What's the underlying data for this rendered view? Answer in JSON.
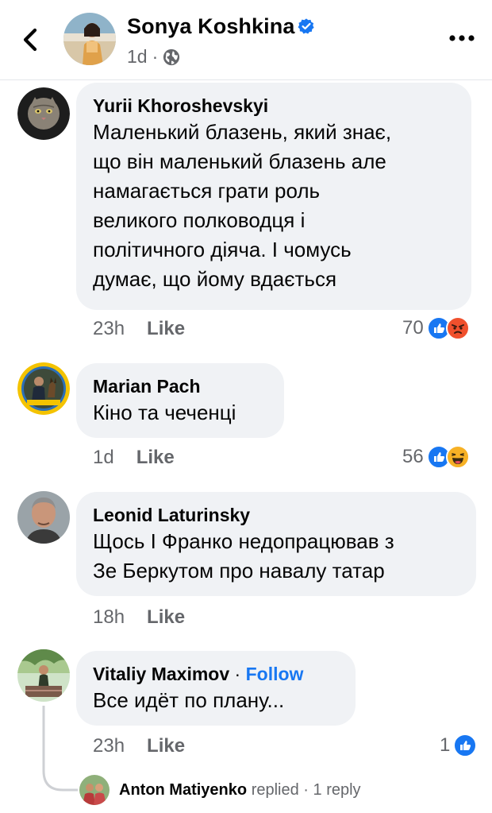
{
  "header": {
    "back_label": "Back",
    "author": "Sonya Koshkina",
    "time": "1d",
    "separator": "·",
    "verified_icon": "verified-badge-icon",
    "privacy_icon": "globe-icon",
    "more_icon": "more-horizontal-icon"
  },
  "colors": {
    "accent": "#1877f2",
    "bubble": "#f0f2f5",
    "secondary_text": "#65676b",
    "angry": "#f0502d",
    "haha": "#f7b125"
  },
  "comments": [
    {
      "author": "Yurii Khoroshevskyi",
      "avatar_icon": "cat-badge-avatar",
      "avatar_badge_text": "YOU DON'T SCARE ME · I HAVE A CAT",
      "text": "Маленький блазень, який знає,\nщо він маленький блазень але\nнамагається грати роль\nвеликого полководця і\nполітичного діяча. І чомусь\nдумає, що йому вдається",
      "time": "23h",
      "like": "Like",
      "reaction_count": "70",
      "reactions": [
        "like",
        "angry"
      ]
    },
    {
      "author": "Marian Pach",
      "avatar_icon": "soldier-with-dog-avatar",
      "avatar_badge_text": "#StandWithUkraine",
      "text": "Кіно та чеченці",
      "time": "1d",
      "like": "Like",
      "reaction_count": "56",
      "reactions": [
        "like",
        "haha"
      ]
    },
    {
      "author": "Leonid Laturinsky",
      "avatar_icon": "man-portrait-avatar",
      "text": "Щось І Франко недопрацював з\nЗе Беркутом про навалу татар",
      "time": "18h",
      "like": "Like"
    },
    {
      "author": "Vitaliy Maximov",
      "follow": "Follow",
      "separator": "·",
      "avatar_icon": "outdoor-photo-avatar",
      "text": "Все идёт по плану...",
      "time": "23h",
      "like": "Like",
      "reaction_count": "1",
      "reactions": [
        "like"
      ],
      "replies": {
        "author": "Anton Matiyenko",
        "verb": "replied",
        "separator": "·",
        "count": "1 reply"
      }
    }
  ]
}
